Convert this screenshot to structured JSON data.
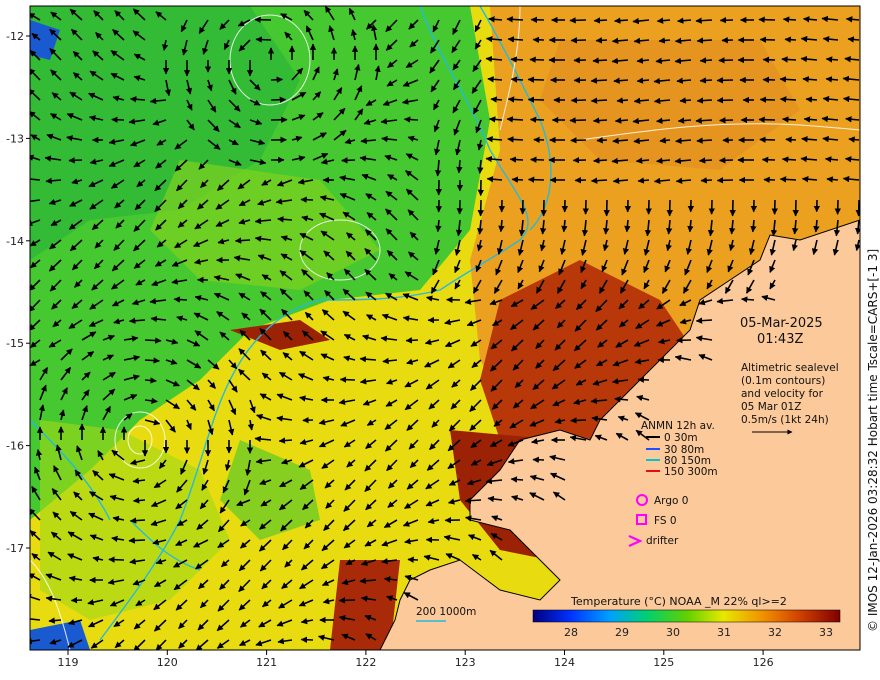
{
  "map": {
    "date": "05-Mar-2025",
    "time": "01:43Z",
    "description_lines": [
      "Altimetric sealevel",
      "(0.1m contours)",
      "and velocity for",
      "05 Mar 01Z",
      "0.5m/s (1kt 24h)"
    ],
    "credit": "© IMOS 12-Jan-2026 03:28:32 Hobart time Tscale=CARS+[-1 3]",
    "lon_ticks": [
      "119",
      "120",
      "121",
      "122",
      "123",
      "124",
      "125",
      "126"
    ],
    "lat_ticks": [
      "-12",
      "-13",
      "-14",
      "-15",
      "-16",
      "-17"
    ]
  },
  "legend": {
    "title": "ANMN 12h av.",
    "items": [
      {
        "label": "0 30m",
        "color": "#000000"
      },
      {
        "label": "30 80m",
        "color": "#1f4fff"
      },
      {
        "label": "80 150m",
        "color": "#00c8c8"
      },
      {
        "label": "150 300m",
        "color": "#e01010"
      }
    ],
    "markers": [
      {
        "label": "Argo 0",
        "symbol": "circle",
        "color": "#ff00ff"
      },
      {
        "label": "FS 0",
        "symbol": "square",
        "color": "#ff00ff"
      },
      {
        "label": "drifter",
        "symbol": "chevron",
        "color": "#ff00ff"
      }
    ]
  },
  "bathymetry": {
    "label": "200  1000m",
    "color": "#22bbdd"
  },
  "colorbar": {
    "title": "Temperature (°C) NOAA _M 22% ql>=2",
    "ticks": [
      "28",
      "29",
      "30",
      "31",
      "32",
      "33"
    ]
  }
}
